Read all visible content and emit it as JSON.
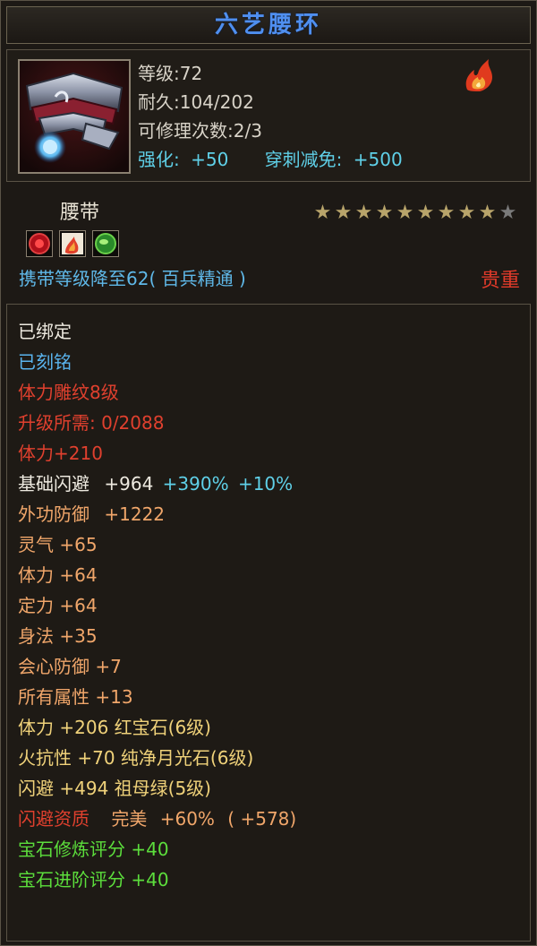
{
  "title": "六艺腰环",
  "item": {
    "icon": "belt-icon",
    "level": "等级:72",
    "durability": "耐久:104/202",
    "repair": "可修理次数:2/3",
    "enhance_label": "强化:",
    "enhance_value": "+50",
    "pierce_label": "穿刺减免:",
    "pierce_value": "+500",
    "fire_icon": "fire-attribute-icon"
  },
  "type": "腰带",
  "stars": {
    "filled": 9,
    "total": 10
  },
  "gems": [
    "ruby-gem-icon",
    "fire-gem-icon",
    "emerald-gem-icon"
  ],
  "requirement": "携带等级降至62( 百兵精通 )",
  "rarity": "贵重",
  "attrs": {
    "bound": "已绑定",
    "engraved": "已刻铭",
    "carving": "体力雕纹8级",
    "upgrade": "升级所需: 0/2088",
    "stamina_bonus": "体力+210",
    "dodge_name": "基础闪避",
    "dodge_val": "+964",
    "dodge_pct1": "+390%",
    "dodge_pct2": "+10%",
    "def_name": "外功防御",
    "def_val": "+1222",
    "spirit": "灵气 +65",
    "stamina": "体力 +64",
    "focus": "定力 +64",
    "agility": "身法 +35",
    "crit_def": "会心防御 +7",
    "all_attr": "所有属性 +13",
    "gem1": "体力 +206 红宝石(6级)",
    "gem2": "火抗性 +70 纯净月光石(6级)",
    "gem3": "闪避 +494 祖母绿(5级)",
    "apt_name": "闪避资质",
    "apt_quality": "完美",
    "apt_val": "+60%",
    "apt_extra": "( +578)",
    "gem_refine": "宝石修炼评分 +40",
    "gem_advance": "宝石进阶评分 +40"
  },
  "colors": {
    "title": "#4f8ff0",
    "white": "#eeeae0",
    "blue": "#5ab4ee",
    "red": "#e0402e",
    "orange": "#f0a66a",
    "green": "#5cde3c",
    "gold_star": "#b8a46a"
  }
}
